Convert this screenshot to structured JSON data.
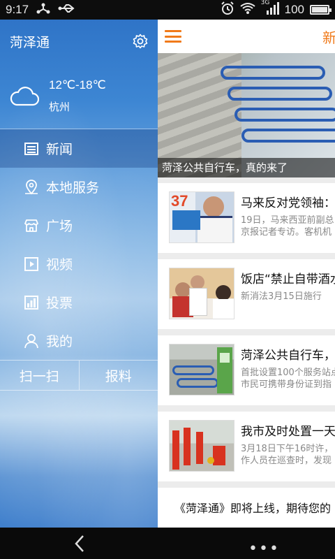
{
  "status_bar": {
    "time": "9:17",
    "battery": "100",
    "network": "3G",
    "battery_level_pct": 100
  },
  "drawer": {
    "app_name": "菏泽通",
    "weather": {
      "temperature": "12℃-18℃",
      "city": "杭州"
    },
    "menu": [
      {
        "label": "新闻",
        "icon": "news-icon",
        "active": true
      },
      {
        "label": "本地服务",
        "icon": "location-pin-icon",
        "active": false
      },
      {
        "label": "广场",
        "icon": "store-icon",
        "active": false
      },
      {
        "label": "视频",
        "icon": "play-icon",
        "active": false
      },
      {
        "label": "投票",
        "icon": "bar-chart-icon",
        "active": false
      },
      {
        "label": "我的",
        "icon": "user-icon",
        "active": false
      }
    ],
    "buttons": {
      "scan": "扫一扫",
      "report": "报料"
    }
  },
  "content": {
    "title": "新闻",
    "hero_caption": "菏泽公共自行车，真的来了",
    "news": [
      {
        "title": "马来反对党领袖：",
        "desc1": "19日，马来西亚前副总",
        "desc2": "京报记者专访。客机机"
      },
      {
        "title": "饭店“禁止自带酒水",
        "desc1": "新消法3月15日施行",
        "desc2": ""
      },
      {
        "title": "菏泽公共自行车，",
        "desc1": "首批设置100个服务站点",
        "desc2": "市民可携带身份证到指"
      },
      {
        "title": "我市及时处置一天",
        "desc1": "3月18日下午16时许，",
        "desc2": "作人员在巡查时，发现"
      }
    ],
    "banner": "《菏泽通》即将上线，期待您的"
  },
  "colors": {
    "accent": "#f07a1a",
    "drawer_blue": "#3d86d3"
  }
}
